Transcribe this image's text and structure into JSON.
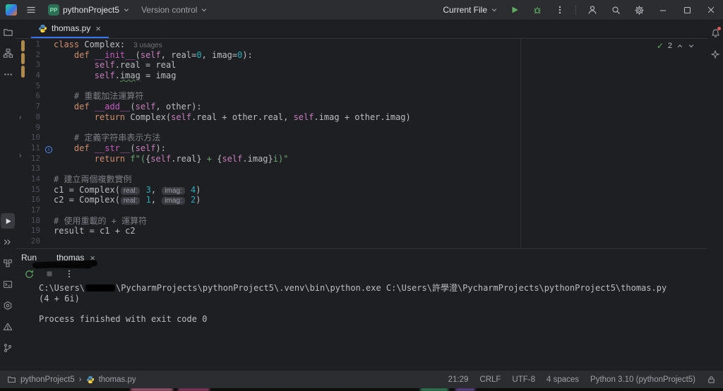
{
  "titlebar": {
    "project_badge": "PP",
    "project_name": "pythonProject5",
    "vcs_label": "Version control",
    "run_config_label": "Current File"
  },
  "tabs": {
    "editor_tab": "thomas.py",
    "close": "×"
  },
  "inspection": {
    "check": "✓",
    "count": "2"
  },
  "editor": {
    "lines": [
      {
        "n": 1,
        "seg": [
          [
            "class ",
            "kw"
          ],
          [
            "Complex:",
            "pln"
          ],
          [
            "3 usages",
            "usage"
          ]
        ]
      },
      {
        "n": 2,
        "seg": [
          [
            "    ",
            "pln"
          ],
          [
            "def ",
            "kw"
          ],
          [
            "__init__",
            "mag"
          ],
          [
            "(",
            "pln"
          ],
          [
            "self",
            "self"
          ],
          [
            ", real=",
            "pln"
          ],
          [
            "0",
            "num"
          ],
          [
            ", imag=",
            "pln"
          ],
          [
            "0",
            "num"
          ],
          [
            "):",
            "pln"
          ]
        ]
      },
      {
        "n": 3,
        "seg": [
          [
            "        ",
            "pln"
          ],
          [
            "self",
            "self"
          ],
          [
            ".real = real",
            "pln"
          ]
        ]
      },
      {
        "n": 4,
        "seg": [
          [
            "        ",
            "pln"
          ],
          [
            "self",
            "self"
          ],
          [
            ".",
            "pln"
          ],
          [
            "imag",
            "typo"
          ],
          [
            " = imag",
            "pln"
          ]
        ]
      },
      {
        "n": 5,
        "seg": []
      },
      {
        "n": 6,
        "seg": [
          [
            "    ",
            "pln"
          ],
          [
            "# 重載加法運算符",
            "com"
          ]
        ]
      },
      {
        "n": 7,
        "seg": [
          [
            "    ",
            "pln"
          ],
          [
            "def ",
            "kw"
          ],
          [
            "__add__",
            "mag"
          ],
          [
            "(",
            "pln"
          ],
          [
            "self",
            "self"
          ],
          [
            ", other):",
            "pln"
          ]
        ]
      },
      {
        "n": 8,
        "seg": [
          [
            "        ",
            "pln"
          ],
          [
            "return ",
            "kw"
          ],
          [
            "Complex(",
            "pln"
          ],
          [
            "self",
            "self"
          ],
          [
            ".real + other.real, ",
            "pln"
          ],
          [
            "self",
            "self"
          ],
          [
            ".imag + other.imag)",
            "pln"
          ]
        ]
      },
      {
        "n": 9,
        "seg": []
      },
      {
        "n": 10,
        "seg": [
          [
            "    ",
            "pln"
          ],
          [
            "# 定義字符串表示方法",
            "com"
          ]
        ]
      },
      {
        "n": 11,
        "gutter": "override",
        "seg": [
          [
            "    ",
            "pln"
          ],
          [
            "def ",
            "kw"
          ],
          [
            "__str__",
            "mag"
          ],
          [
            "(",
            "pln"
          ],
          [
            "self",
            "self"
          ],
          [
            "):",
            "pln"
          ]
        ]
      },
      {
        "n": 12,
        "seg": [
          [
            "        ",
            "pln"
          ],
          [
            "return ",
            "kw"
          ],
          [
            "f\"(",
            "str"
          ],
          [
            "{",
            "pln"
          ],
          [
            "self",
            "self"
          ],
          [
            ".real",
            "pln"
          ],
          [
            "}",
            "pln"
          ],
          [
            " + ",
            "str"
          ],
          [
            "{",
            "pln"
          ],
          [
            "self",
            "self"
          ],
          [
            ".imag",
            "pln"
          ],
          [
            "}",
            "pln"
          ],
          [
            "i)\"",
            "str"
          ]
        ]
      },
      {
        "n": 13,
        "seg": []
      },
      {
        "n": 14,
        "seg": [
          [
            "# 建立兩個複數實例",
            "com"
          ]
        ]
      },
      {
        "n": 15,
        "seg": [
          [
            "c1 = Complex(",
            "pln"
          ],
          [
            "real:",
            "hint"
          ],
          [
            " ",
            "pln"
          ],
          [
            "3",
            "num"
          ],
          [
            ", ",
            "pln"
          ],
          [
            "imag:",
            "hint"
          ],
          [
            " ",
            "pln"
          ],
          [
            "4",
            "num"
          ],
          [
            ")",
            "pln"
          ]
        ]
      },
      {
        "n": 16,
        "seg": [
          [
            "c2 = Complex(",
            "pln"
          ],
          [
            "real:",
            "hint"
          ],
          [
            " ",
            "pln"
          ],
          [
            "1",
            "num"
          ],
          [
            ", ",
            "pln"
          ],
          [
            "imag:",
            "hint"
          ],
          [
            " ",
            "pln"
          ],
          [
            "2",
            "num"
          ],
          [
            ")",
            "pln"
          ]
        ]
      },
      {
        "n": 17,
        "seg": []
      },
      {
        "n": 18,
        "seg": [
          [
            "# 使用重載的 + 運算符",
            "com"
          ]
        ]
      },
      {
        "n": 19,
        "seg": [
          [
            "result = c1 + c2",
            "pln"
          ]
        ]
      },
      {
        "n": 20,
        "seg": []
      }
    ]
  },
  "run": {
    "title": "Run",
    "tab_label": "thomas",
    "close": "×"
  },
  "console": {
    "lines": [
      {
        "seg": [
          [
            "C:\\Users\\",
            "pln"
          ],
          [
            "",
            "redact"
          ],
          [
            "\\PycharmProjects\\pythonProject5\\.venv\\bin\\python.exe C:\\Users\\許學澄\\PycharmProjects\\pythonProject5\\thomas.py",
            "pln"
          ]
        ]
      },
      {
        "seg": [
          [
            "(4 + 6i)",
            "pln"
          ]
        ]
      },
      {
        "seg": []
      },
      {
        "seg": [
          [
            "Process finished with exit code 0",
            "pln"
          ]
        ]
      }
    ]
  },
  "statusbar": {
    "project": "pythonProject5",
    "separator": "›",
    "file": "thomas.py",
    "items": [
      "21:29",
      "CRLF",
      "UTF-8",
      "4 spaces",
      "Python 3.10 (pythonProject5)"
    ]
  },
  "icons": {
    "pycharm-logo": "gradient-square",
    "hamburger-menu": "three-lines",
    "chevron-down": "v",
    "run": "green-play-triangle",
    "debug": "green-bug",
    "more-vertical": "kebab-dots",
    "user": "person",
    "search": "magnifier",
    "settings": "gear",
    "minimize": "dash",
    "maximize": "square",
    "close": "x",
    "project-folder": "folder",
    "structure": "boxes-tree",
    "more-horizontal": "ellipsis",
    "python-console": "double-chevron",
    "python-packages": "stacked-boxes",
    "terminal": "prompt-box",
    "services": "hexagon",
    "problems": "warning-triangle",
    "notifications-bell": "bell-with-red-dot",
    "ai-assistant": "sparkle",
    "python-file": "python-logo",
    "override-method": "blue-circle-up-arrow",
    "rerun": "green-circular-arrow",
    "stop": "gray-square",
    "lock": "open-padlock"
  }
}
